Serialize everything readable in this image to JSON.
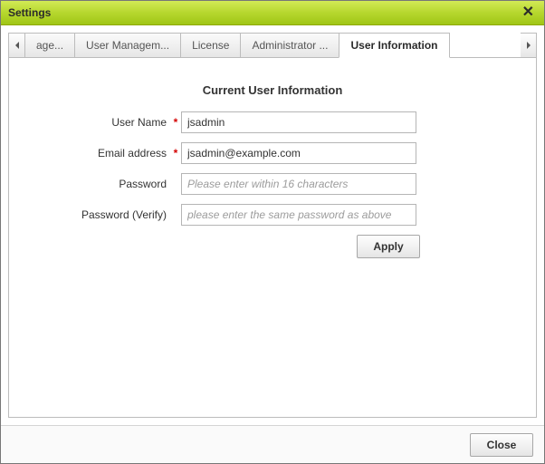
{
  "window": {
    "title": "Settings"
  },
  "tabs": {
    "prev_partial": "age...",
    "t1": "User Managem...",
    "t2": "License",
    "t3": "Administrator ...",
    "t4": "User Information"
  },
  "section": {
    "title": "Current User Information"
  },
  "form": {
    "username_label": "User Name",
    "username_value": "jsadmin",
    "email_label": "Email address",
    "email_value": "jsadmin@example.com",
    "password_label": "Password",
    "password_placeholder": "Please enter within 16 characters",
    "password_verify_label": "Password (Verify)",
    "password_verify_placeholder": "please enter the same password as above"
  },
  "buttons": {
    "apply": "Apply",
    "close": "Close"
  }
}
